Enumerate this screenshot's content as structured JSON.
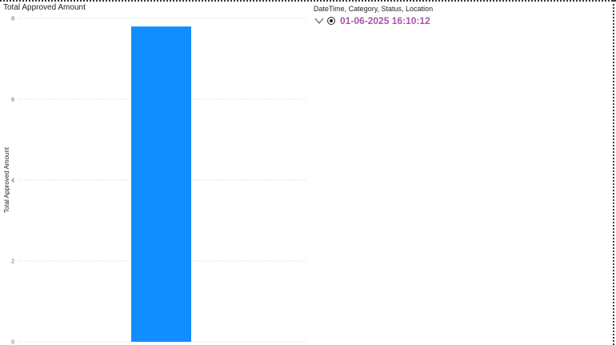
{
  "visual": {
    "title": "Total Approved Amount"
  },
  "chart_data": {
    "type": "bar",
    "title": "Total Approved Amount",
    "xlabel": "",
    "ylabel": "Total Approved Amount",
    "categories": [
      ""
    ],
    "series": [
      {
        "values": [
          7.8
        ],
        "color": "#118DFF"
      }
    ],
    "ylim": [
      0,
      8
    ],
    "yticks": [
      0,
      2,
      4,
      6,
      8
    ],
    "ytick_labels": [
      "0",
      "2",
      "4",
      "6",
      "8"
    ],
    "grid": true,
    "legend": "none"
  },
  "slicer": {
    "header": "DateTime, Category, Status, Location",
    "selected_value": "01-06-2025 16:10:12",
    "expand_icon": "chevron-down-icon",
    "selection_icon": "radio-selected-icon",
    "value_color": "#a357a8"
  }
}
